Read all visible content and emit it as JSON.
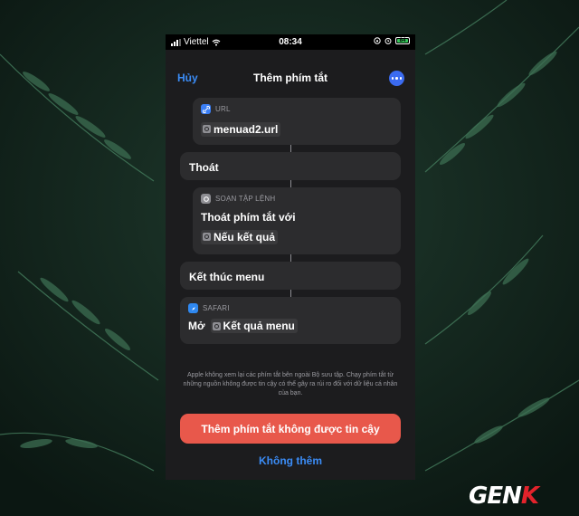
{
  "status": {
    "carrier": "Viettel",
    "time": "08:34",
    "battery": "84",
    "icons": [
      "signal-icon",
      "wifi-icon",
      "lock-rotation-icon",
      "alarm-icon",
      "battery-icon"
    ]
  },
  "nav": {
    "cancel": "Hủy",
    "title": "Thêm phím tắt",
    "more_icon": "ellipsis-icon"
  },
  "actions": {
    "url": {
      "header": "URL",
      "token": "menuad2.url"
    },
    "exit": {
      "label": "Thoát"
    },
    "script": {
      "header": "SOẠN TẬP LỆNH",
      "line": "Thoát phím tắt với",
      "token": "Nếu kết quả"
    },
    "end_menu": {
      "label": "Kết thúc menu"
    },
    "safari": {
      "header": "SAFARI",
      "prefix": "Mở",
      "token": "Kết quả menu"
    }
  },
  "disclaimer": "Apple không xem lại các phím tắt bên ngoài Bộ sưu tập. Chạy phím tắt từ những nguồn không được tin cậy có thể gây ra rủi ro đối với dữ liệu cá nhân của bạn.",
  "buttons": {
    "add_untrusted": "Thêm phím tắt không được tin cậy",
    "dont_add": "Không thêm"
  },
  "watermark": {
    "part1": "GEN",
    "part2": "K"
  },
  "colors": {
    "accent": "#3b8cf6",
    "danger": "#e8584b",
    "card": "#2c2c2e",
    "sheet": "#1c1c1e"
  }
}
